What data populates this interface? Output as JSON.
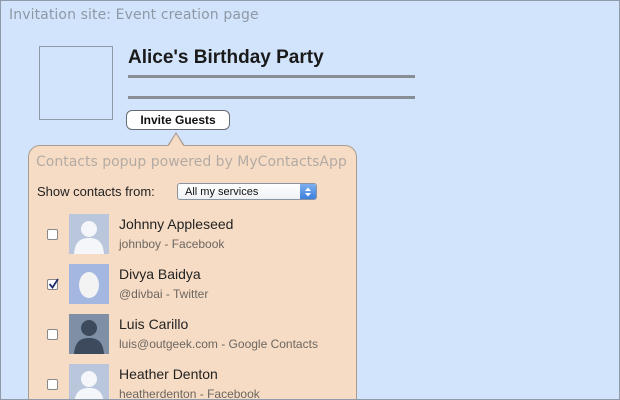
{
  "page": {
    "caption": "Invitation site: Event creation page"
  },
  "event": {
    "title": "Alice's Birthday Party",
    "invite_button_label": "Invite Guests"
  },
  "popup": {
    "header": "Contacts popup powered by MyContactsApp",
    "show_from_label": "Show contacts from:",
    "selected_service": "All my services",
    "contacts": [
      {
        "name": "Johnny Appleseed",
        "handle": "johnboy",
        "service": "Facebook",
        "meta": "johnboy - Facebook",
        "checked": false,
        "avatar": "silhouette-placeholder-icon"
      },
      {
        "name": "Divya Baidya",
        "handle": "@divbai",
        "service": "Twitter",
        "meta": "@divbai - Twitter",
        "checked": true,
        "avatar": "egg-avatar-icon"
      },
      {
        "name": "Luis Carillo",
        "handle": "luis@outgeek.com",
        "service": "Google Contacts",
        "meta": "luis@outgeek.com - Google Contacts",
        "checked": false,
        "avatar": "dark-silhouette-icon"
      },
      {
        "name": "Heather Denton",
        "handle": "heatherdenton",
        "service": "Facebook",
        "meta": "heatherdenton - Facebook",
        "checked": false,
        "avatar": "silhouette-placeholder-icon"
      }
    ]
  },
  "colors": {
    "page_background": "#d2e4fb",
    "popup_background": "#f7dcc5",
    "select_accent": "#3d7fdc"
  }
}
